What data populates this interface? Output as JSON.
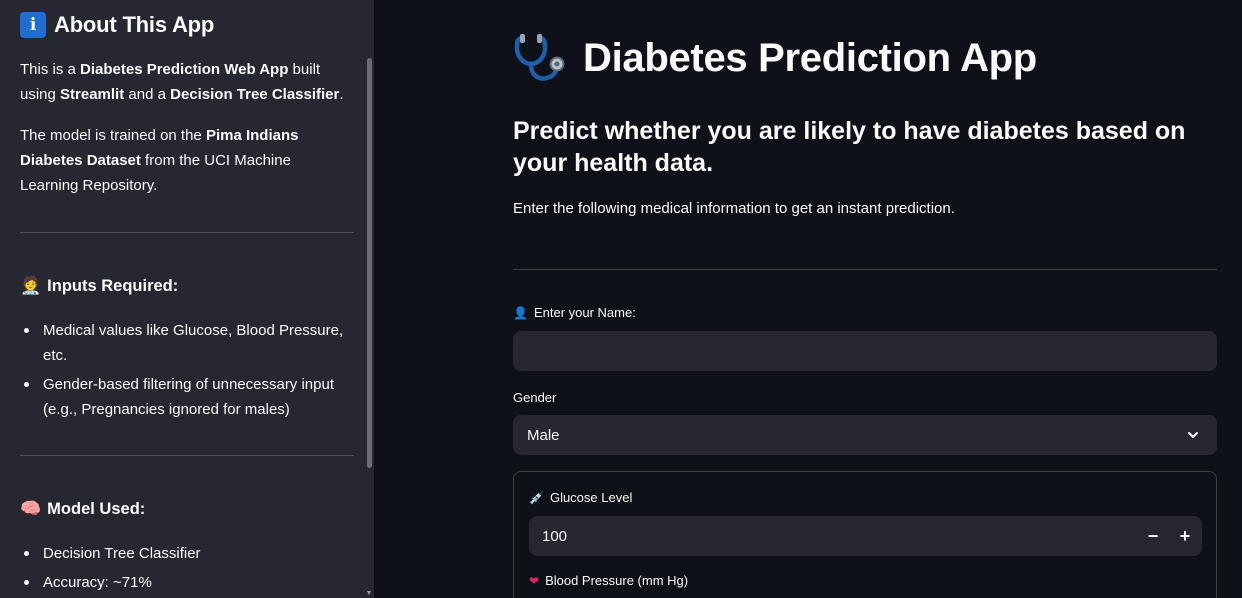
{
  "sidebar": {
    "title": "About This App",
    "intro": {
      "p1": "This is a ",
      "b1": "Diabetes Prediction Web App",
      "p2": " built using ",
      "b2": "Streamlit",
      "p3": " and a ",
      "b3": "Decision Tree Classifier",
      "p4": "."
    },
    "dataset": {
      "p1": "The model is trained on the ",
      "b1": "Pima Indians Diabetes Dataset",
      "p2": " from the UCI Machine Learning Repository."
    },
    "inputs_heading": "Inputs Required:",
    "inputs_items": [
      "Medical values like Glucose, Blood Pressure, etc.",
      "Gender-based filtering of unnecessary input (e.g., Pregnancies ignored for males)"
    ],
    "model_heading": "Model Used:",
    "model_items": [
      "Decision Tree Classifier",
      "Accuracy: ~71%"
    ]
  },
  "main": {
    "title": "Diabetes Prediction App",
    "subtitle": "Predict whether you are likely to have diabetes based on your health data.",
    "description": "Enter the following medical information to get an instant prediction.",
    "name_label": "Enter your Name:",
    "name_value": "",
    "gender_label": "Gender",
    "gender_value": "Male",
    "glucose_label": "Glucose Level",
    "glucose_value": "100",
    "minus_label": "−",
    "plus_label": "+",
    "bp_label": "Blood Pressure (mm Hg)"
  },
  "icons": {
    "info": "info-icon",
    "doctor": "doctor-emoji-icon",
    "brain": "brain-emoji-icon",
    "stethoscope": "stethoscope-icon",
    "person": "bust-silhouette-icon",
    "syringe": "syringe-icon",
    "heart": "heart-icon"
  },
  "colors": {
    "background": "#0e1117",
    "sidebar": "#262730",
    "input": "#262730",
    "info_blue": "#1f6fd1",
    "heart_red": "#e0245e"
  }
}
